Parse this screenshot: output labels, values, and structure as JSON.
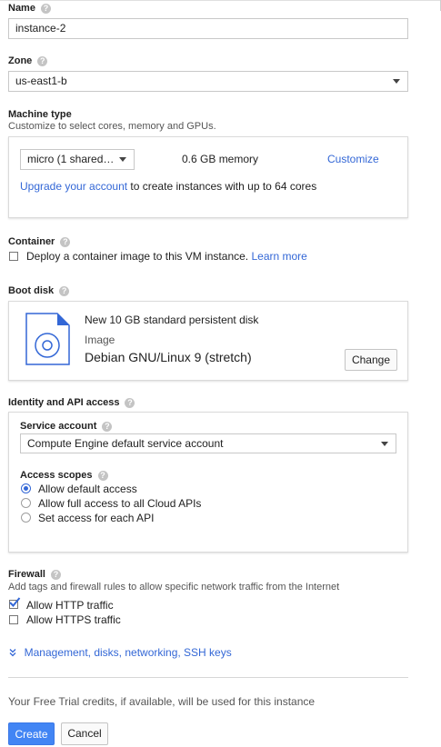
{
  "name": {
    "label": "Name",
    "value": "instance-2"
  },
  "zone": {
    "label": "Zone",
    "value": "us-east1-b"
  },
  "machine_type": {
    "label": "Machine type",
    "hint": "Customize to select cores, memory and GPUs.",
    "select_value": "micro (1 shared…",
    "memory": "0.6 GB memory",
    "customize": "Customize",
    "upgrade_link": "Upgrade your account",
    "upgrade_rest": "to create instances with up to 64 cores"
  },
  "container": {
    "label": "Container",
    "checkbox_label": "Deploy a container image to this VM instance.",
    "learn_more": "Learn more"
  },
  "boot_disk": {
    "label": "Boot disk",
    "disk_title": "New 10 GB standard persistent disk",
    "image_label": "Image",
    "image_value": "Debian GNU/Linux 9 (stretch)",
    "change": "Change"
  },
  "identity": {
    "label": "Identity and API access",
    "service_account_label": "Service account",
    "service_account_value": "Compute Engine default service account",
    "scopes_label": "Access scopes",
    "scopes": [
      {
        "label": "Allow default access",
        "selected": true
      },
      {
        "label": "Allow full access to all Cloud APIs",
        "selected": false
      },
      {
        "label": "Set access for each API",
        "selected": false
      }
    ]
  },
  "firewall": {
    "label": "Firewall",
    "hint": "Add tags and firewall rules to allow specific network traffic from the Internet",
    "options": [
      {
        "label": "Allow HTTP traffic",
        "checked": true
      },
      {
        "label": "Allow HTTPS traffic",
        "checked": false
      }
    ]
  },
  "management_link": "Management, disks, networking, SSH keys",
  "free_trial_note": "Your Free Trial credits, if available, will be used for this instance",
  "actions": {
    "create": "Create",
    "cancel": "Cancel"
  },
  "icons": {
    "help": "?",
    "expand": "chevron-double-down-icon"
  },
  "colors": {
    "accent": "#3367d6",
    "primary_button": "#4285f4"
  }
}
